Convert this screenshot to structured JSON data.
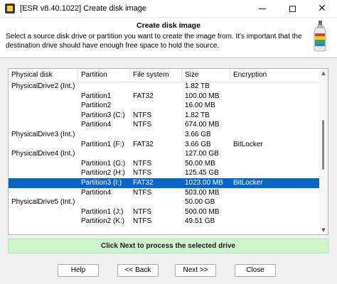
{
  "window": {
    "title": "[ESR v8.40.1022]  Create disk image",
    "min_glyph": "minimize-icon",
    "max_glyph": "maximize-icon",
    "close_glyph": "✕"
  },
  "header": {
    "title": "Create disk image",
    "description": "Select a source disk drive or partition you want to create the image from. It's important that the destination drive should have enough free space to hold the source.",
    "icon": "paste-bottle-icon"
  },
  "list": {
    "columns": [
      "Physical disk",
      "Partition",
      "File system",
      "Size",
      "Encryption"
    ],
    "rows": [
      {
        "disk": "PhysicalDrive2 (Int.)",
        "partition": "",
        "fs": "",
        "size": "1.82 TB",
        "encryption": ""
      },
      {
        "disk": "",
        "partition": "Partition1",
        "fs": "FAT32",
        "size": "100.00 MB",
        "encryption": ""
      },
      {
        "disk": "",
        "partition": "Partition2",
        "fs": "",
        "size": "16.00 MB",
        "encryption": ""
      },
      {
        "disk": "",
        "partition": "Partition3 (C:)",
        "fs": "NTFS",
        "size": "1.82 TB",
        "encryption": ""
      },
      {
        "disk": "",
        "partition": "Partition4",
        "fs": "NTFS",
        "size": "674.00 MB",
        "encryption": ""
      },
      {
        "disk": "PhysicalDrive3 (Int.)",
        "partition": "",
        "fs": "",
        "size": "3.66 GB",
        "encryption": ""
      },
      {
        "disk": "",
        "partition": "Partition1 (F:)",
        "fs": "FAT32",
        "size": "3.66 GB",
        "encryption": "BitLocker"
      },
      {
        "disk": "PhysicalDrive4 (Int.)",
        "partition": "",
        "fs": "",
        "size": "127.00 GB",
        "encryption": ""
      },
      {
        "disk": "",
        "partition": "Partition1 (G:)",
        "fs": "NTFS",
        "size": "50.00 MB",
        "encryption": ""
      },
      {
        "disk": "",
        "partition": "Partition2 (H:)",
        "fs": "NTFS",
        "size": "125.45 GB",
        "encryption": ""
      },
      {
        "disk": "",
        "partition": "Partition3 (I:)",
        "fs": "FAT32",
        "size": "1023.00 MB",
        "encryption": "BitLocker",
        "selected": true
      },
      {
        "disk": "",
        "partition": "Partition4",
        "fs": "NTFS",
        "size": "503.00 MB",
        "encryption": ""
      },
      {
        "disk": "PhysicalDrive5 (Int.)",
        "partition": "",
        "fs": "",
        "size": "50.00 GB",
        "encryption": ""
      },
      {
        "disk": "",
        "partition": "Partition1 (J:)",
        "fs": "NTFS",
        "size": "500.00 MB",
        "encryption": ""
      },
      {
        "disk": "",
        "partition": "Partition2 (K:)",
        "fs": "NTFS",
        "size": "49.51 GB",
        "encryption": ""
      }
    ]
  },
  "status": {
    "text": "Click Next to process the selected drive"
  },
  "buttons": {
    "help": "Help",
    "back": "<< Back",
    "next": "Next >>",
    "close": "Close"
  },
  "colors": {
    "selection": "#0a64c8",
    "status_bg": "#ccf5cc"
  }
}
